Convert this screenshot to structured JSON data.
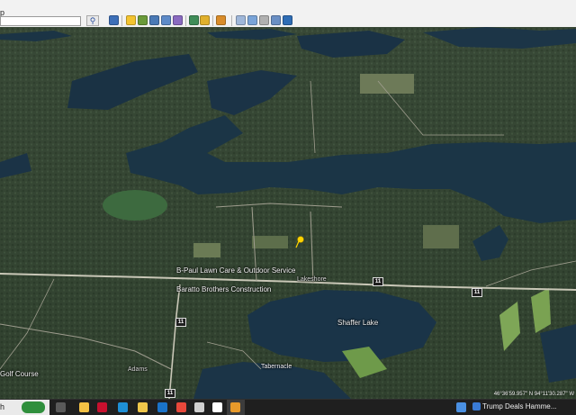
{
  "window": {
    "menu_fragment": "p",
    "search_value": "",
    "search_button_icon": "search-icon"
  },
  "map": {
    "labels": {
      "lake": "Shaffer Lake",
      "business_1": "B-Paul Lawn Care & Outdoor Service",
      "business_2": "Baratto Brothers Construction",
      "road_name": "Lakeshore",
      "golf": "Golf Course",
      "tabernacle": "Tabernacle",
      "place_south": "Tabernacle",
      "road_west": "Adams"
    },
    "shields": [
      "11",
      "11",
      "11",
      "11"
    ],
    "coordinates": "46°36'59.957\" N    94°11'30.287\" W"
  },
  "taskbar": {
    "left_fragment": "h",
    "news_text": "Trump Deals Hamme..."
  },
  "colors": {
    "toolbar_bg": "#f2f2f2",
    "water": "#1b3445",
    "forest": "#3a4a3a",
    "taskbar": "#1f1f1f"
  }
}
